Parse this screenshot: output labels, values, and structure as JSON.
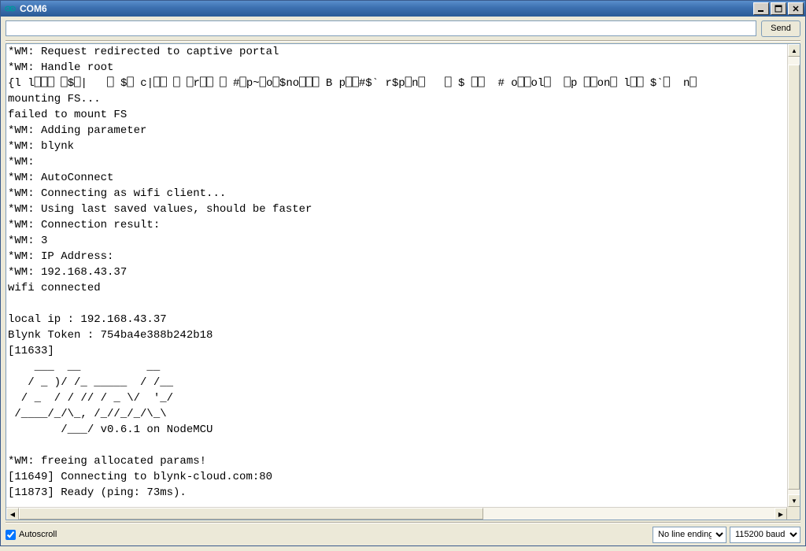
{
  "window": {
    "title": "COM6"
  },
  "toolbar": {
    "send_label": "Send",
    "input_value": ""
  },
  "console": {
    "lines": [
      "*WM: Request redirected to captive portal",
      "*WM: Handle root",
      "{l l⎕⎕⎕ ⎕$⎕|   ⎕ $⎕ c|⎕⎕ ⎕ ⎕r⎕⎕ ⎕ #⎕p~⎕o⎕$no⎕⎕⎕ B p⎕⎕#$` r$p⎕n⎕   ⎕ $ ⎕⎕  # o⎕⎕ol⎕  ⎕p ⎕⎕on⎕ l⎕⎕ $`⎕  n⎕",
      "mounting FS...",
      "failed to mount FS",
      "*WM: Adding parameter",
      "*WM: blynk",
      "*WM: ",
      "*WM: AutoConnect",
      "*WM: Connecting as wifi client...",
      "*WM: Using last saved values, should be faster",
      "*WM: Connection result: ",
      "*WM: 3",
      "*WM: IP Address:",
      "*WM: 192.168.43.37",
      "wifi connected",
      "",
      "local ip : 192.168.43.37",
      "Blynk Token : 754ba4e388b242b18",
      "[11633] ",
      "    ___  __          __",
      "   / _ )/ /_ _____  / /__",
      "  / _  / / // / _ \\/  '_/",
      " /____/_/\\_, /_//_/_/\\_\\",
      "        /___/ v0.6.1 on NodeMCU",
      "",
      "*WM: freeing allocated params!",
      "[11649] Connecting to blynk-cloud.com:80",
      "[11873] Ready (ping: 73ms).",
      ""
    ]
  },
  "footer": {
    "autoscroll_label": "Autoscroll",
    "autoscroll_checked": true,
    "line_ending_selected": "No line ending",
    "baud_selected": "115200 baud"
  }
}
